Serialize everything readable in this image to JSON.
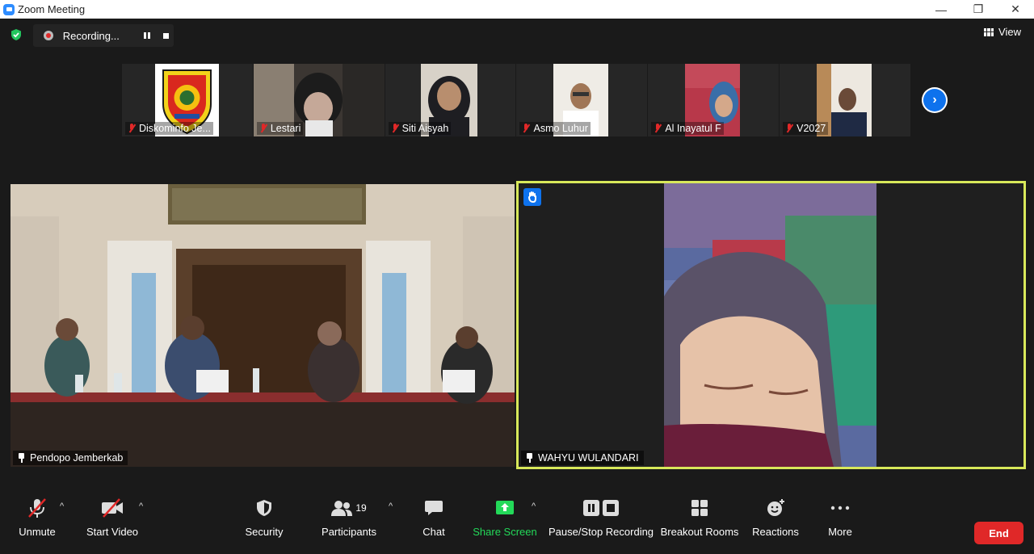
{
  "window": {
    "title": "Zoom Meeting",
    "minimize": "—",
    "restore": "❐",
    "close": "✕"
  },
  "recording": {
    "label": "Recording..."
  },
  "view": {
    "label": "View"
  },
  "thumbnails": [
    {
      "name": "Diskominfo Je..."
    },
    {
      "name": "Lestari"
    },
    {
      "name": "Siti Aisyah"
    },
    {
      "name": "Asmo Luhur"
    },
    {
      "name": "Al Inayatul F"
    },
    {
      "name": "V2027"
    }
  ],
  "main_tile": {
    "name": "Pendopo Jemberkab"
  },
  "speaker_tile": {
    "name": "WAHYU WULANDARI"
  },
  "toolbar": {
    "unmute": "Unmute",
    "start_video": "Start Video",
    "security": "Security",
    "participants": "Participants",
    "participants_count": "19",
    "chat": "Chat",
    "share_screen": "Share Screen",
    "pause_stop_recording": "Pause/Stop Recording",
    "breakout_rooms": "Breakout Rooms",
    "reactions": "Reactions",
    "more": "More",
    "end": "End"
  },
  "colors": {
    "active_speaker_border": "#d8e85a",
    "share_green": "#23d959",
    "end_red": "#e02828",
    "zoom_blue": "#0e72ed"
  }
}
